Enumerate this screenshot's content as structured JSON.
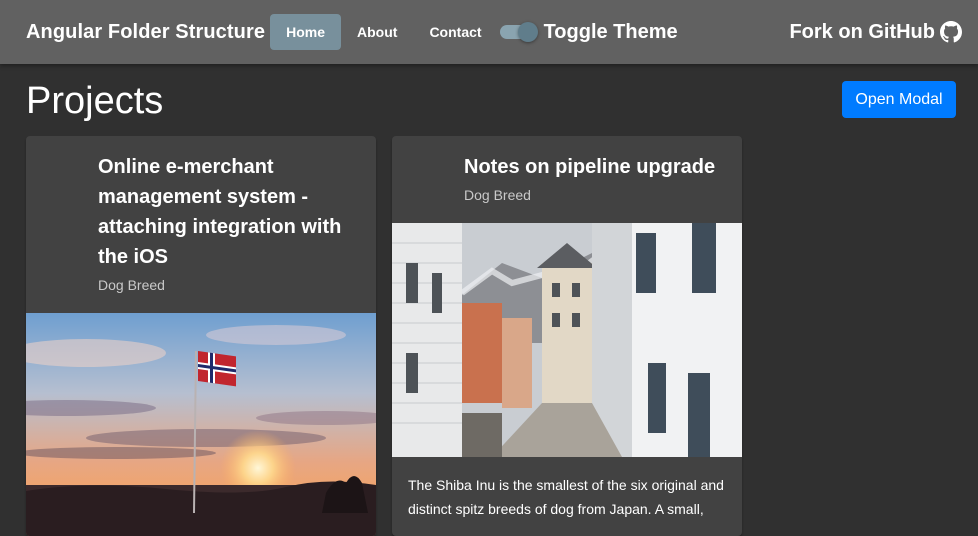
{
  "navbar": {
    "brand": "Angular Folder Structure",
    "links": [
      {
        "label": "Home",
        "active": true
      },
      {
        "label": "About",
        "active": false
      },
      {
        "label": "Contact",
        "active": false
      }
    ],
    "toggle_label": "Toggle Theme",
    "toggle_on": true,
    "github_label": "Fork on GitHub"
  },
  "page": {
    "title": "Projects",
    "open_modal_label": "Open Modal"
  },
  "cards": [
    {
      "title": "Online e-merchant management system - attaching integration with the iOS",
      "subtitle": "Dog Breed",
      "image": "norway-flag-sunset",
      "text": ""
    },
    {
      "title": "Notes on pipeline upgrade",
      "subtitle": "Dog Breed",
      "image": "bergen-street",
      "text": "The Shiba Inu is the smallest of the six original and distinct spitz breeds of dog from Japan. A small,"
    }
  ],
  "colors": {
    "background": "#303030",
    "toolbar": "#616161",
    "card": "#424242",
    "active_nav": "#78909c",
    "primary_button": "#007bff"
  }
}
